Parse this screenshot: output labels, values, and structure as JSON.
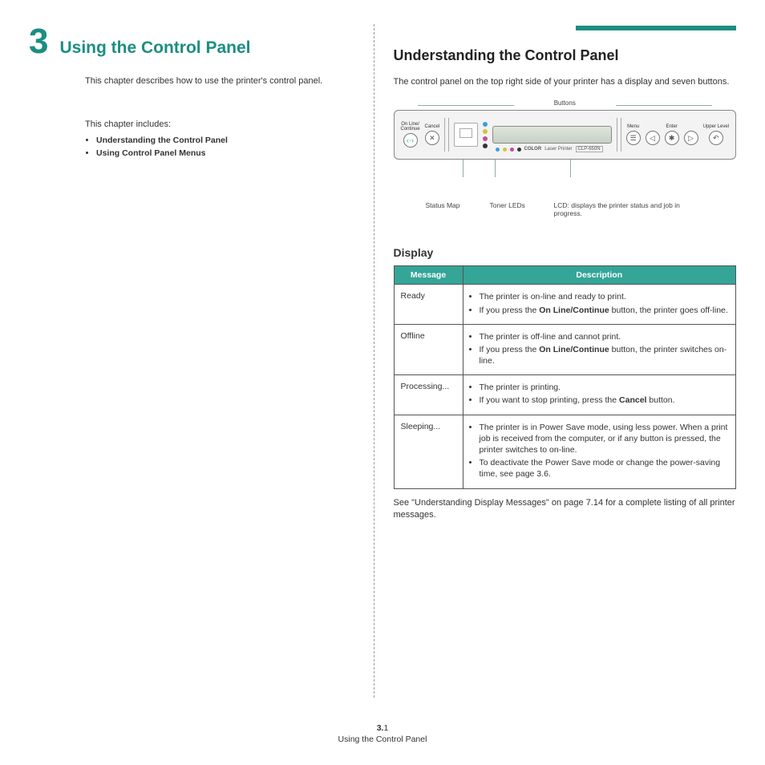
{
  "chapter": {
    "number": "3",
    "title": "Using the Control Panel",
    "intro": "This chapter describes how to use the printer's control panel.",
    "includes_label": "This chapter includes:",
    "toc": [
      "Understanding the Control Panel",
      "Using Control Panel Menus"
    ]
  },
  "section": {
    "title": "Understanding the Control Panel",
    "intro": "The control panel on the top right side of your printer has a display and seven buttons."
  },
  "diagram": {
    "top_label": "Buttons",
    "buttons_left": [
      {
        "label_line1": "On Line/",
        "label_line2": "Continue",
        "glyph": "‹·›"
      },
      {
        "label_line1": "Cancel",
        "label_line2": "",
        "glyph": "✕"
      }
    ],
    "buttons_right": [
      {
        "label": "Menu",
        "glyph": "☰"
      },
      {
        "label": "",
        "glyph": "◁"
      },
      {
        "label": "Enter",
        "glyph": "✱"
      },
      {
        "label": "",
        "glyph": "▷"
      },
      {
        "label": "Upper Level",
        "glyph": "↶"
      }
    ],
    "model_brand_bold": "COLOR",
    "model_brand_small": "Laser Printer",
    "model_number": "CLP-650N",
    "callouts": {
      "status_map": "Status Map",
      "toner": "Toner LEDs",
      "lcd": "LCD: displays the printer status and job in progress."
    },
    "toner_colors": [
      "#3aa0d8",
      "#d6c23a",
      "#c84a9a",
      "#333333"
    ]
  },
  "display": {
    "title": "Display",
    "headers": [
      "Message",
      "Description"
    ],
    "rows": [
      {
        "msg": "Ready",
        "desc": [
          {
            "pre": "The printer is on-line and ready to print."
          },
          {
            "pre": "If you press the ",
            "bold": "On Line/Continue",
            "post": " button, the printer goes off-line."
          }
        ]
      },
      {
        "msg": "Offline",
        "desc": [
          {
            "pre": "The printer is off-line and cannot print."
          },
          {
            "pre": "If you press the ",
            "bold": "On Line/Continue",
            "post": " button, the printer switches on-line."
          }
        ]
      },
      {
        "msg": "Processing...",
        "desc": [
          {
            "pre": "The printer is printing."
          },
          {
            "pre": "If you want to stop printing, press the ",
            "bold": "Cancel",
            "post": " button."
          }
        ]
      },
      {
        "msg": "Sleeping...",
        "desc": [
          {
            "pre": "The printer is in Power Save mode, using less power. When a print job is received from the computer, or if any button is pressed, the printer switches to on-line."
          },
          {
            "pre": "To deactivate the Power Save mode or change the power-saving time, see page 3.6."
          }
        ]
      }
    ],
    "note": "See \"Understanding Display Messages\" on page 7.14 for a complete listing of all printer messages."
  },
  "footer": {
    "page_chapter": "3.",
    "page_num": "1",
    "title": "Using the Control Panel"
  }
}
